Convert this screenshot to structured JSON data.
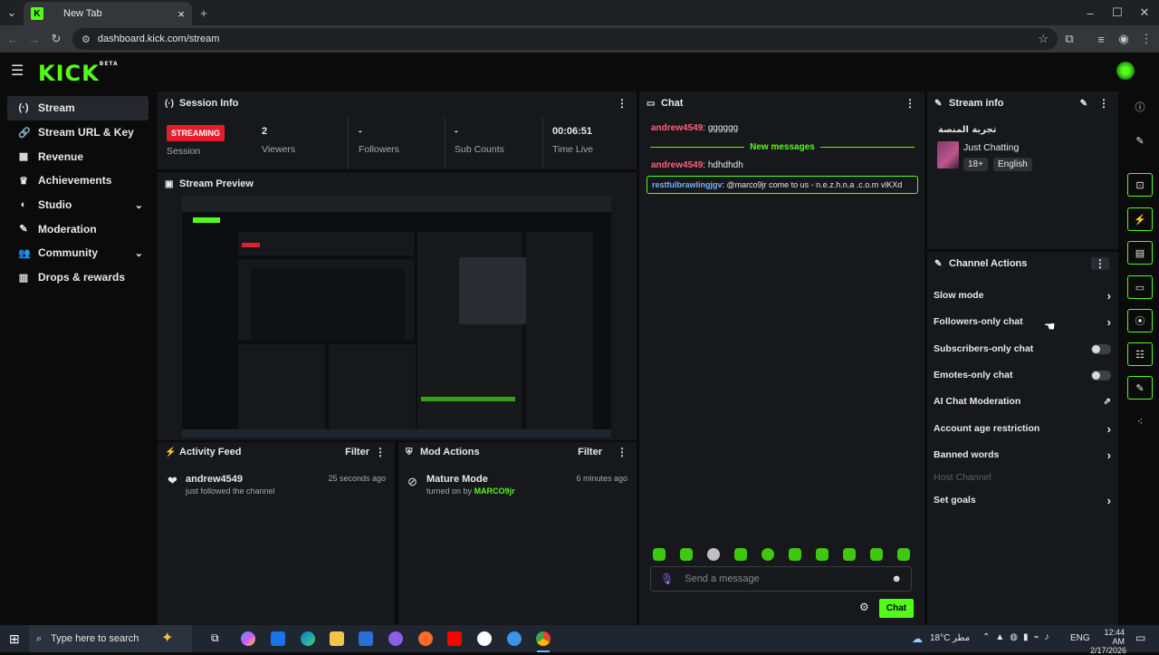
{
  "browser": {
    "tab_title": "New Tab",
    "url": "dashboard.kick.com/stream",
    "new_tab_symbol": "+",
    "close_symbol": "×",
    "favicon_letter": "K"
  },
  "header": {
    "logo": "KICK",
    "logo_sup": "BETA"
  },
  "sidebar": {
    "items": [
      {
        "label": "Stream",
        "icon": "stream-icon"
      },
      {
        "label": "Stream URL & Key",
        "icon": "link-icon"
      },
      {
        "label": "Revenue",
        "icon": "revenue-icon"
      },
      {
        "label": "Achievements",
        "icon": "trophy-icon"
      },
      {
        "label": "Studio",
        "icon": "palette-icon"
      },
      {
        "label": "Moderation",
        "icon": "wrench-icon"
      },
      {
        "label": "Community",
        "icon": "users-icon"
      },
      {
        "label": "Drops & rewards",
        "icon": "gift-icon"
      }
    ]
  },
  "session_info": {
    "title": "Session Info",
    "streaming_badge": "STREAMING",
    "session_label": "Session",
    "stats": [
      {
        "value": "2",
        "label": "Viewers"
      },
      {
        "value": "-",
        "label": "Followers"
      },
      {
        "value": "-",
        "label": "Sub Counts"
      },
      {
        "value": "00:06:51",
        "label": "Time Live"
      }
    ]
  },
  "stream_preview": {
    "title": "Stream Preview"
  },
  "activity_feed": {
    "title": "Activity Feed",
    "filter": "Filter",
    "items": [
      {
        "user": "andrew4549",
        "text": "just followed the channel",
        "time": "25 seconds ago"
      }
    ]
  },
  "mod_actions": {
    "title": "Mod Actions",
    "filter": "Filter",
    "items": [
      {
        "title": "Mature Mode",
        "prefix": "turned on by",
        "by": "MARCO9jr",
        "time": "6 minutes ago"
      }
    ]
  },
  "chat": {
    "title": "Chat",
    "messages": [
      {
        "user": "andrew4549",
        "text": ": gggggg"
      },
      {
        "user": "andrew4549",
        "text": ": hdhdhdh"
      }
    ],
    "new_messages": "New messages",
    "highlighted": {
      "user": "restfulbrawlingjgv",
      "text": ": @marco9jr come to us - n.e.z.h.n.a .c.o.m vlKXd"
    },
    "input_placeholder": "Send a message",
    "send_label": "Chat"
  },
  "stream_info": {
    "title": "Stream info",
    "stream_title": "تجربة المنصة",
    "category": "Just Chatting",
    "tags": [
      "18+",
      "English"
    ]
  },
  "channel_actions": {
    "title": "Channel Actions",
    "rows": [
      {
        "label": "Slow mode",
        "control": "chevron"
      },
      {
        "label": "Followers-only chat",
        "control": "chevron"
      },
      {
        "label": "Subscribers-only chat",
        "control": "toggle"
      },
      {
        "label": "Emotes-only chat",
        "control": "toggle"
      },
      {
        "label": "AI Chat Moderation",
        "control": "external"
      },
      {
        "label": "Account age restriction",
        "control": "chevron"
      },
      {
        "label": "Banned words",
        "control": "chevron"
      },
      {
        "label": "Host Channel",
        "control": "none"
      },
      {
        "label": "Set goals",
        "control": "chevron"
      }
    ]
  },
  "taskbar": {
    "search_placeholder": "Type here to search",
    "weather": "18°C",
    "weather_text": "مطر",
    "lang": "ENG",
    "time": "12:44 AM",
    "date": "2/17/2026"
  },
  "colors": {
    "accent": "#53fc18",
    "danger": "#e41d2c",
    "panel": "#17181b",
    "bg": "#0b0b0c"
  }
}
